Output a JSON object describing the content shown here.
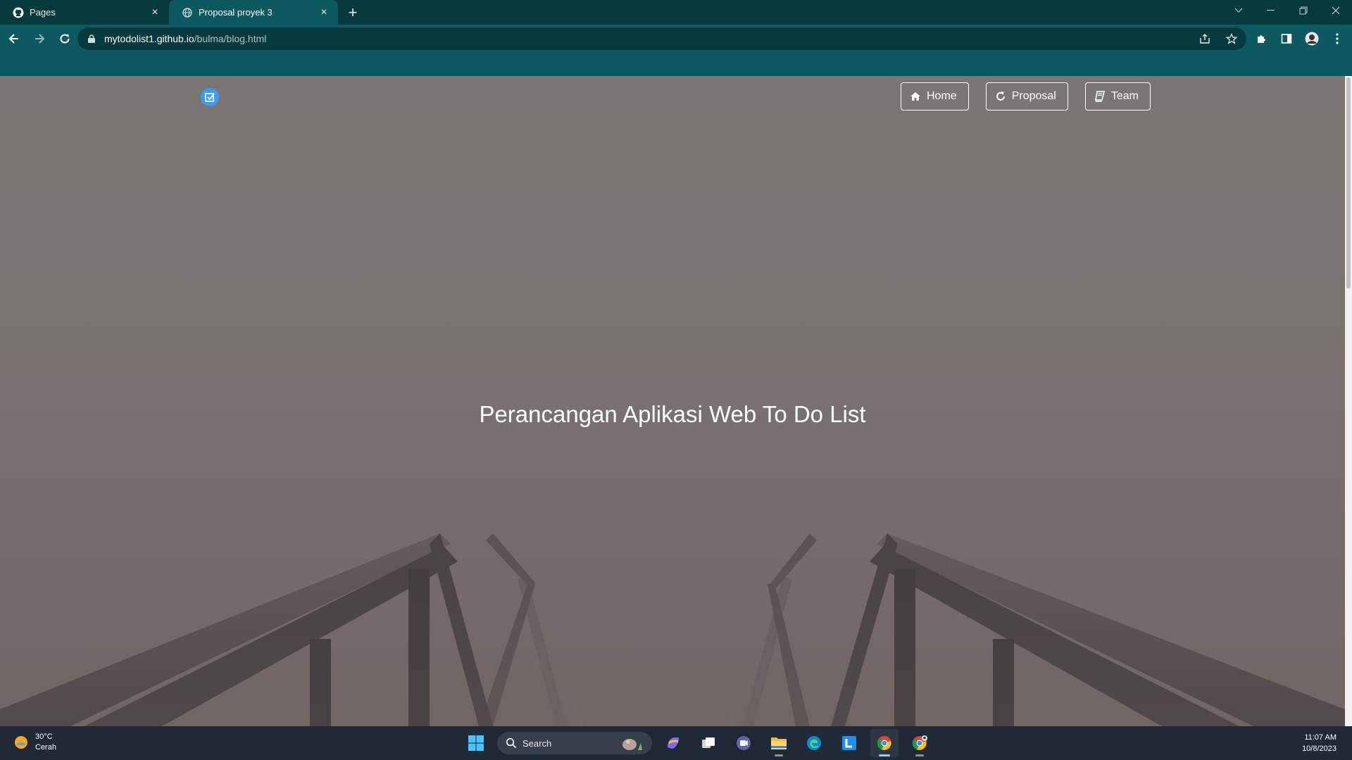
{
  "browser": {
    "tabs": [
      {
        "title": "Pages",
        "icon": "github-icon",
        "active": false
      },
      {
        "title": "Proposal proyek 3",
        "icon": "globe-icon",
        "active": true
      }
    ],
    "close_glyph": "×",
    "newtab_glyph": "+",
    "url_host": "mytodolist1.github.io",
    "url_path": "/bulma/blog.html",
    "accent_color": "#0d5960",
    "dark_color": "#063a3f"
  },
  "page": {
    "nav": [
      {
        "label": "Home",
        "icon": "home-icon"
      },
      {
        "label": "Proposal",
        "icon": "refresh-icon"
      },
      {
        "label": "Team",
        "icon": "book-icon"
      }
    ],
    "logo_icon": "checkbox-icon",
    "hero_title": "Perancangan Aplikasi Web To Do List"
  },
  "taskbar": {
    "weather_temp": "30°C",
    "weather_desc": "Cerah",
    "search_label": "Search",
    "time": "11:07 AM",
    "date": "10/8/2023",
    "apps": [
      "copilot-icon",
      "task-view-icon",
      "teams-icon",
      "file-explorer-icon",
      "edge-icon",
      "l-app-icon",
      "chrome-icon",
      "chrome-profile-icon"
    ]
  }
}
